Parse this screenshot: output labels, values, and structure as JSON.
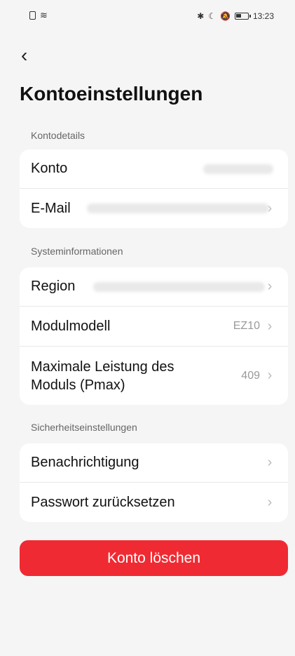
{
  "status_bar": {
    "time": "13:23",
    "icons": [
      "sim-icon",
      "wifi-icon",
      "bluetooth-icon",
      "do-not-disturb-icon",
      "mute-icon",
      "battery-icon"
    ]
  },
  "header": {
    "back_icon": "chevron-left-icon",
    "title": "Kontoeinstellungen"
  },
  "sections": {
    "account_details": {
      "label": "Kontodetails",
      "rows": [
        {
          "label": "Konto",
          "value": "",
          "value_blurred": true
        },
        {
          "label": "E-Mail",
          "value": "",
          "value_blurred": true
        }
      ]
    },
    "system_info": {
      "label": "Systeminformationen",
      "rows": [
        {
          "label": "Region",
          "value": "",
          "value_blurred": true
        },
        {
          "label": "Modulmodell",
          "value": "EZ10"
        },
        {
          "label": "Maximale Leistung des Moduls (Pmax)",
          "value": "409"
        }
      ]
    },
    "security": {
      "label": "Sicherheitseinstellungen",
      "rows": [
        {
          "label": "Benachrichtigung",
          "value": ""
        },
        {
          "label": "Passwort zurücksetzen",
          "value": ""
        }
      ]
    }
  },
  "actions": {
    "delete_account_label": "Konto löschen"
  },
  "colors": {
    "background": "#f5f5f5",
    "card": "#ffffff",
    "delete_button": "#f02a32",
    "secondary_text": "#9a9a9a"
  }
}
